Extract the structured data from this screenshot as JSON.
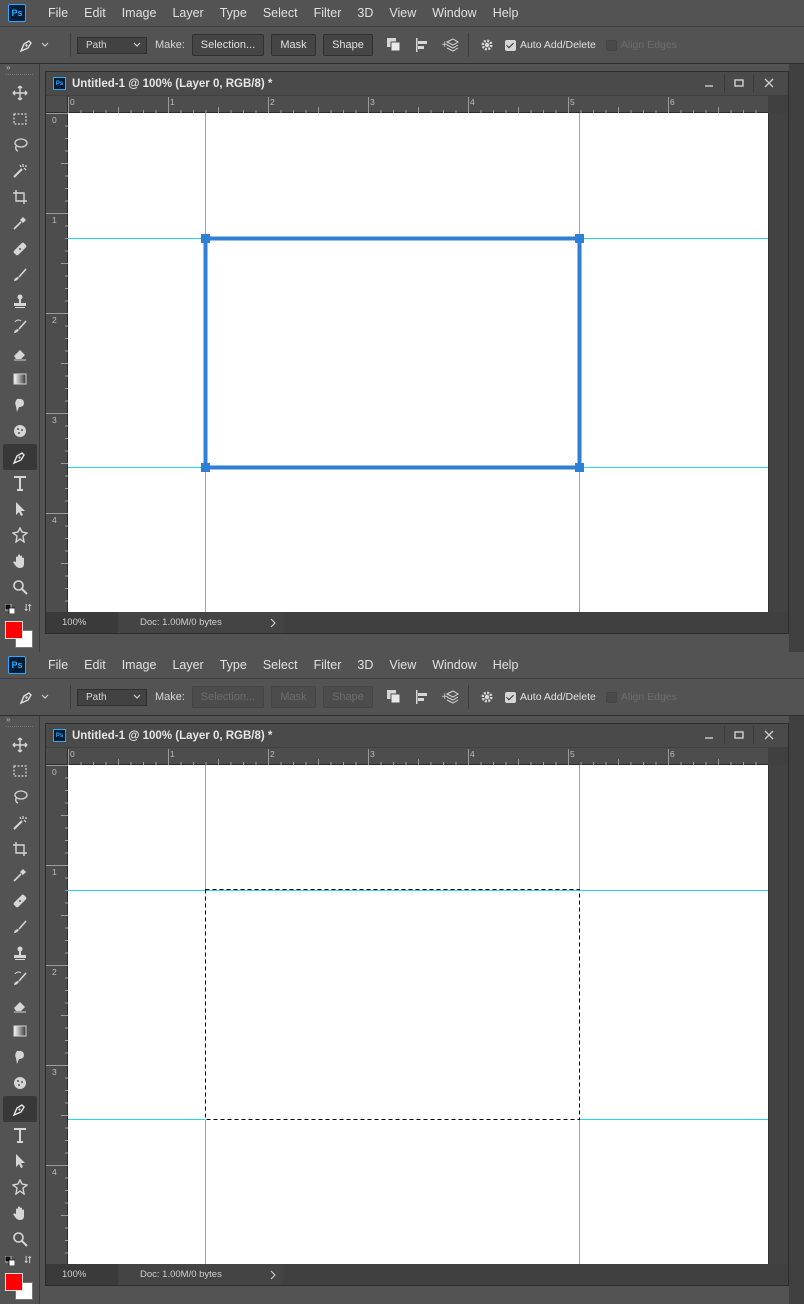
{
  "app": {
    "logo": "Ps"
  },
  "menu": [
    "File",
    "Edit",
    "Image",
    "Layer",
    "Type",
    "Select",
    "Filter",
    "3D",
    "View",
    "Window",
    "Help"
  ],
  "options": {
    "tool_icon": "pen-icon",
    "mode": "Path",
    "make_label": "Make:",
    "selection_label": "Selection...",
    "mask_label": "Mask",
    "shape_label": "Shape",
    "auto_add_delete": "Auto Add/Delete",
    "align_edges": "Align Edges"
  },
  "tools": [
    "move-tool",
    "marquee-tool",
    "lasso-tool",
    "magic-wand-tool",
    "crop-tool",
    "eyedropper-tool",
    "healing-brush-tool",
    "brush-tool",
    "clone-stamp-tool",
    "history-brush-tool",
    "eraser-tool",
    "gradient-tool",
    "smudge-tool",
    "dodge-tool",
    "pen-tool",
    "type-tool",
    "path-selection-tool",
    "custom-shape-tool",
    "hand-tool",
    "zoom-tool"
  ],
  "colors": {
    "foreground": "#ff0000",
    "background": "#ffffff",
    "accent": "#2f7fd6",
    "guide": "#2ad4e8"
  },
  "document": {
    "title": "Untitled-1 @ 100% (Layer 0, RGB/8) *",
    "zoom": "100%",
    "doc_info": "Doc: 1.00M/0 bytes",
    "ruler_h_labels": [
      "0",
      "1",
      "2",
      "3",
      "4",
      "5",
      "6"
    ],
    "ruler_v_labels": [
      "0",
      "1",
      "2",
      "3",
      "4"
    ]
  },
  "states": [
    {
      "id": "path-drawn",
      "make_buttons_enabled": true,
      "path": "rectangular work path with four anchor points"
    },
    {
      "id": "selection-made",
      "make_buttons_enabled": false,
      "path": "marching-ants selection"
    }
  ]
}
